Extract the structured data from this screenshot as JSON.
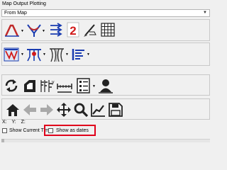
{
  "window": {
    "title": "Map Output Plotting"
  },
  "mode_select": {
    "value": "From Map"
  },
  "toolbar_rows": [
    [
      "section-plot",
      "cross-section",
      "arrows-plot",
      "number-plot",
      "paint-plot",
      "grid-table"
    ],
    [
      "curtain-plot",
      "curtain-dd",
      "stations-plot",
      "stations-dd",
      "barbs-plot",
      "barbs-dd",
      "list-plot",
      "list-dd"
    ],
    [
      "refresh",
      "polygon",
      "vector-fields",
      "ruler",
      "attributes-list",
      "attributes-dd",
      "user-profile"
    ],
    [
      "home",
      "back",
      "forward",
      "pan",
      "zoom",
      "chart",
      "save"
    ]
  ],
  "coords": {
    "x_label": "X:",
    "y_label": "Y:",
    "z_label": "Z:"
  },
  "options": {
    "show_current_time": "Show Current Time",
    "show_as_dates": "Show as dates"
  },
  "accent": {
    "highlight": "#e0001b",
    "red_icon": "#d11a1a",
    "blue_icon": "#1a3cb0"
  }
}
